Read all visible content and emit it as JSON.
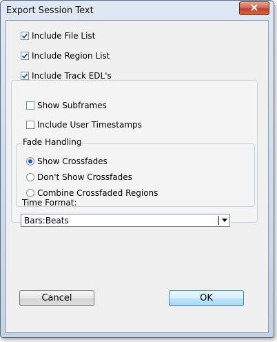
{
  "window": {
    "title": "Export Session Text"
  },
  "options": {
    "include_file_list": {
      "label": "Include File List",
      "checked": true
    },
    "include_region_list": {
      "label": "Include Region List",
      "checked": true
    },
    "include_track_edls": {
      "label": "Include Track EDL's",
      "checked": true
    },
    "show_subframes": {
      "label": "Show Subframes",
      "checked": false
    },
    "include_user_timestamps": {
      "label": "Include User Timestamps",
      "checked": false
    }
  },
  "fade_handling": {
    "title": "Fade Handling",
    "options": [
      {
        "label": "Show Crossfades",
        "selected": true
      },
      {
        "label": "Don't Show Crossfades",
        "selected": false
      },
      {
        "label": "Combine Crossfaded Regions",
        "selected": false
      }
    ]
  },
  "time_format": {
    "label": "Time Format:",
    "value": "Bars:Beats"
  },
  "buttons": {
    "cancel": "Cancel",
    "ok": "OK"
  },
  "icons": {
    "close": "close-icon",
    "check": "checkmark-icon",
    "dropdown": "chevron-down-icon"
  },
  "colors": {
    "accent": "#1f5ab8",
    "close_button": "#c0412a"
  }
}
